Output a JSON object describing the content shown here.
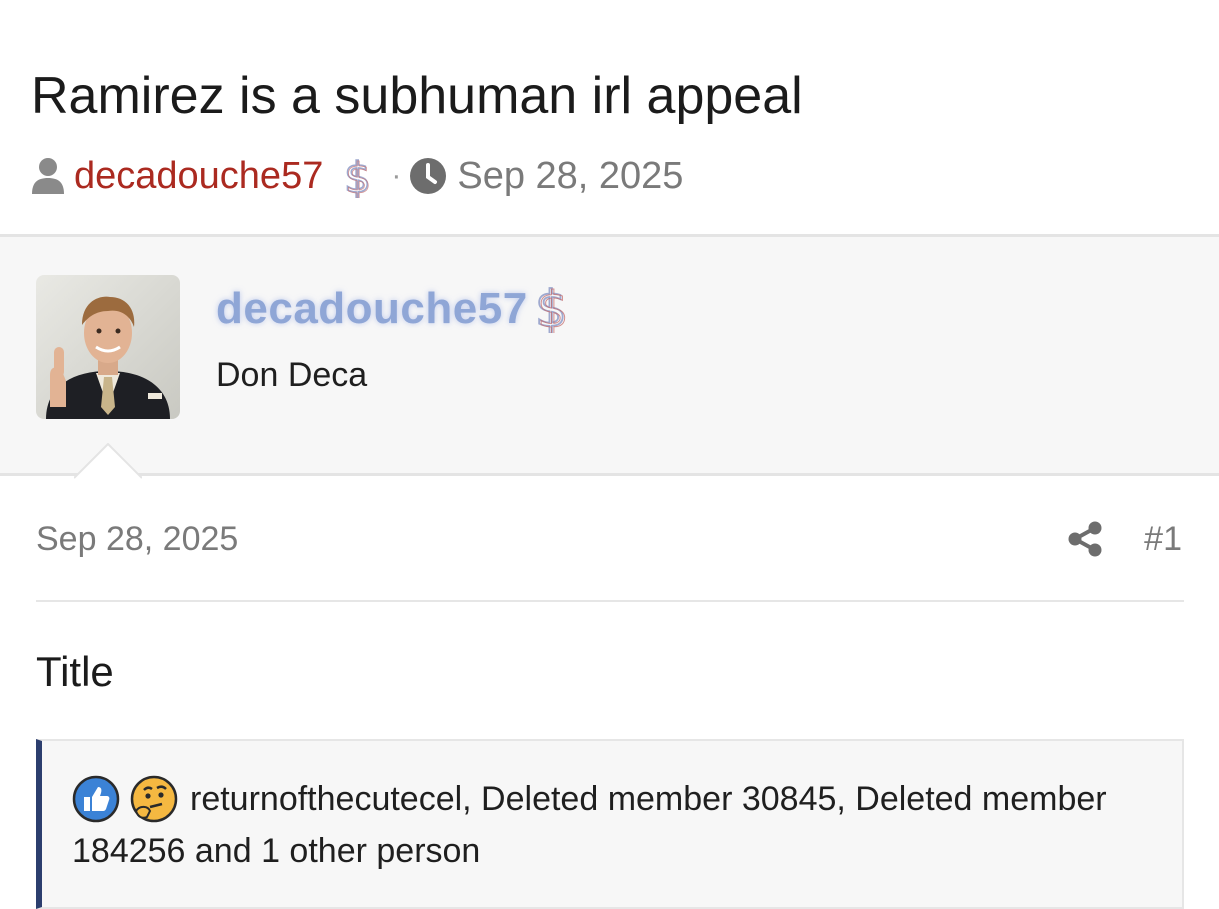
{
  "thread": {
    "title": "Ramirez is a subhuman irl appeal",
    "author": "decadouche57",
    "separator": "·",
    "date": "Sep 28, 2025"
  },
  "user": {
    "name": "decadouche57",
    "title": "Don Deca",
    "name_color": "#8fa6d6"
  },
  "post": {
    "date": "Sep 28, 2025",
    "number": "#1",
    "body": "Title"
  },
  "reactions": {
    "icons": [
      "like-icon",
      "thinking-face-icon"
    ],
    "text": "returnofthecutecel, Deleted member 30845, Deleted member 184256 and 1 other person"
  },
  "colors": {
    "author_red": "#ab2a20",
    "accent_navy": "#2c3e6e",
    "like_blue": "#3b82d6"
  }
}
